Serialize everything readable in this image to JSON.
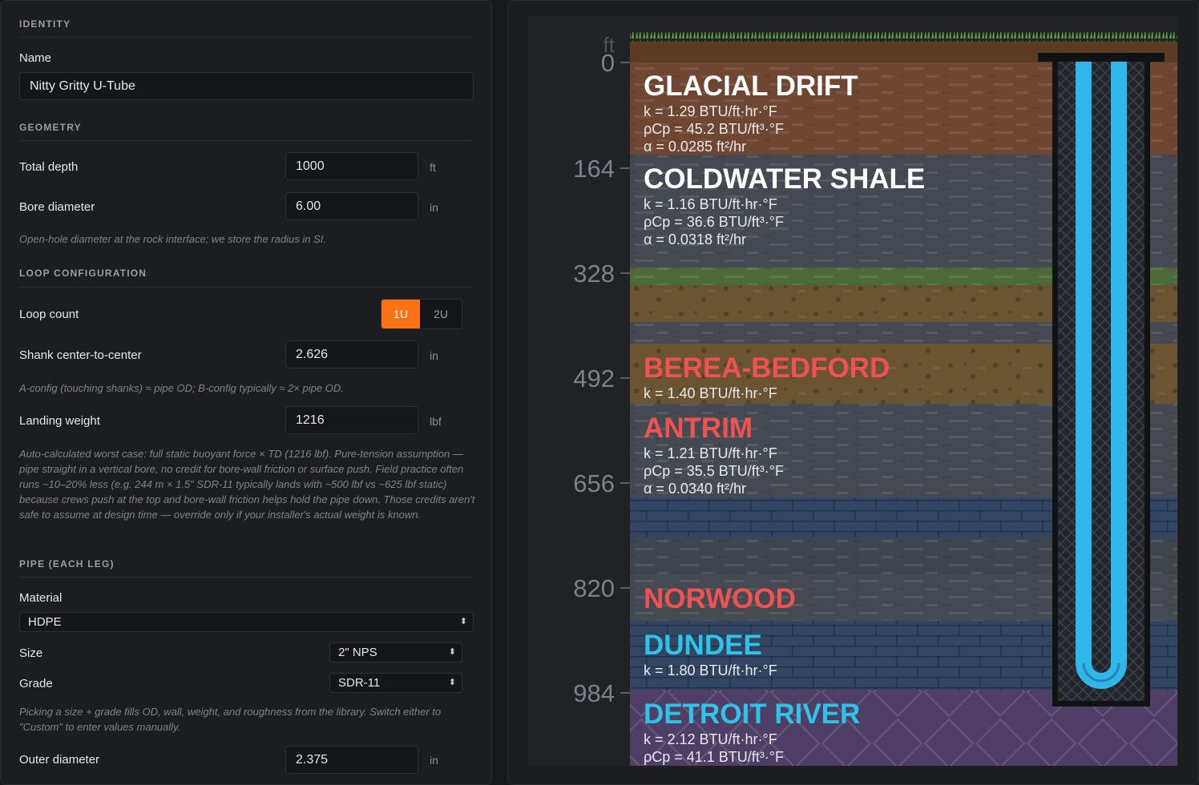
{
  "sections": {
    "identity": "IDENTITY",
    "geometry": "GEOMETRY",
    "loop": "LOOP CONFIGURATION",
    "pipe": "PIPE (EACH LEG)"
  },
  "fields": {
    "name": {
      "label": "Name",
      "value": "Nitty Gritty U-Tube"
    },
    "total_depth": {
      "label": "Total depth",
      "value": "1000",
      "unit": "ft"
    },
    "bore_diameter": {
      "label": "Bore diameter",
      "value": "6.00",
      "unit": "in",
      "note": "Open-hole diameter at the rock interface; we store the radius in SI."
    },
    "loop_count": {
      "label": "Loop count",
      "options": [
        "1U",
        "2U"
      ],
      "selected": "1U"
    },
    "shank": {
      "label": "Shank center-to-center",
      "value": "2.626",
      "unit": "in",
      "note": "A-config (touching shanks) ≈ pipe OD; B-config typically ≈ 2× pipe OD."
    },
    "landing_weight": {
      "label": "Landing weight",
      "value": "1216",
      "unit": "lbf",
      "note": "Auto-calculated worst case: full static buoyant force × TD (1216 lbf). Pure-tension assumption — pipe straight in a vertical bore, no credit for bore-wall friction or surface push. Field practice often runs ~10–20% less (e.g. 244 m × 1.5\" SDR-11 typically lands with ~500 lbf vs ~625 lbf static) because crews push at the top and bore-wall friction helps hold the pipe down. Those credits aren't safe to assume at design time — override only if your installer's actual weight is known."
    },
    "material": {
      "label": "Material",
      "value": "HDPE"
    },
    "size": {
      "label": "Size",
      "value": "2\" NPS"
    },
    "grade": {
      "label": "Grade",
      "value": "SDR-11",
      "note": "Picking a size + grade fills OD, wall, weight, and roughness from the library. Switch either to \"Custom\" to enter values manually."
    },
    "outer_diameter": {
      "label": "Outer diameter",
      "value": "2.375",
      "unit": "in"
    }
  },
  "accent_color": "#f97316",
  "depth_axis": {
    "unit": "ft",
    "ticks": [
      "0",
      "164",
      "328",
      "492",
      "656",
      "820",
      "984"
    ]
  },
  "strata": [
    {
      "name": "GLACIAL DRIFT",
      "name_color": "#ffffff",
      "props": [
        "k = 1.29 BTU/ft·hr·°F",
        "ρCp = 45.2 BTU/ft³·°F",
        "α = 0.0285 ft²/hr"
      ]
    },
    {
      "name": "COLDWATER SHALE",
      "name_color": "#ffffff",
      "props": [
        "k = 1.16 BTU/ft·hr·°F",
        "ρCp = 36.6 BTU/ft³·°F",
        "α = 0.0318 ft²/hr"
      ]
    },
    {
      "name": "BEREA-BEDFORD",
      "name_color": "#f05252",
      "props": [
        "k = 1.40 BTU/ft·hr·°F"
      ]
    },
    {
      "name": "ANTRIM",
      "name_color": "#f05252",
      "props": [
        "k = 1.21 BTU/ft·hr·°F",
        "ρCp = 35.5 BTU/ft³·°F",
        "α = 0.0340 ft²/hr"
      ]
    },
    {
      "name": "NORWOOD",
      "name_color": "#f05252",
      "props": []
    },
    {
      "name": "DUNDEE",
      "name_color": "#2ec4ea",
      "props": [
        "k = 1.80 BTU/ft·hr·°F"
      ]
    },
    {
      "name": "DETROIT RIVER",
      "name_color": "#2ec4ea",
      "props": [
        "k = 2.12 BTU/ft·hr·°F",
        "ρCp = 41.1 BTU/ft³·°F"
      ]
    }
  ]
}
